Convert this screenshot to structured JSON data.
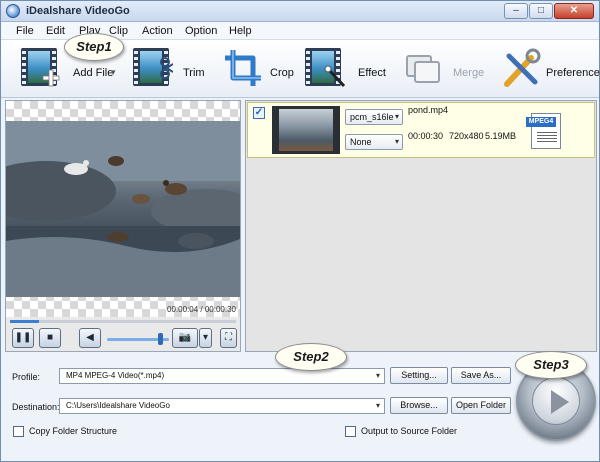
{
  "window": {
    "title": "iDealshare VideoGo",
    "controls": {
      "minimize": "‒",
      "maximize": "□",
      "close": "✕"
    }
  },
  "menu": [
    "File",
    "Edit",
    "Play",
    "Clip",
    "Action",
    "Option",
    "Help"
  ],
  "toolbar": {
    "add_file": "Add File",
    "trim": "Trim",
    "crop": "Crop",
    "effect": "Effect",
    "merge": "Merge",
    "preference": "Preference"
  },
  "callouts": {
    "step1": "Step1",
    "step2": "Step2",
    "step3": "Step3"
  },
  "player": {
    "timecode": "00:00:04 / 00:00:30",
    "progress": 0.13,
    "volume": 0.85,
    "pause_glyph": "❚❚",
    "stop_glyph": "■",
    "speaker_glyph": "◀",
    "camera_glyph": "📷",
    "dropdown_glyph": "▾",
    "fullscreen_glyph": "⛶"
  },
  "file": {
    "checked": true,
    "check_glyph": "✓",
    "audio_option": "pcm_s16le",
    "subtitle_option": "None",
    "name": "pond.mp4",
    "duration": "00:00:30",
    "resolution": "720x480",
    "size": "5.19MB",
    "format_badge": "MPEG4"
  },
  "output": {
    "profile_label": "Profile:",
    "profile_value": "MP4 MPEG-4 Video(*.mp4)",
    "setting_button": "Setting...",
    "save_as_button": "Save As...",
    "destination_label": "Destination:",
    "destination_value": "C:\\Users\\Idealshare VideoGo",
    "browse_button": "Browse...",
    "open_folder_button": "Open Folder",
    "copy_folder_label": "Copy Folder Structure",
    "output_to_source_label": "Output to Source Folder"
  },
  "colors": {
    "accent": "#3b7fd3",
    "selected_row": "#ffffe8",
    "window_bg": "#eef3fa"
  },
  "icons": [
    "app-icon",
    "add-file-icon",
    "trim-icon",
    "crop-icon",
    "effect-icon",
    "merge-icon",
    "preference-icon",
    "mpeg4-file-icon",
    "convert-icon"
  ]
}
